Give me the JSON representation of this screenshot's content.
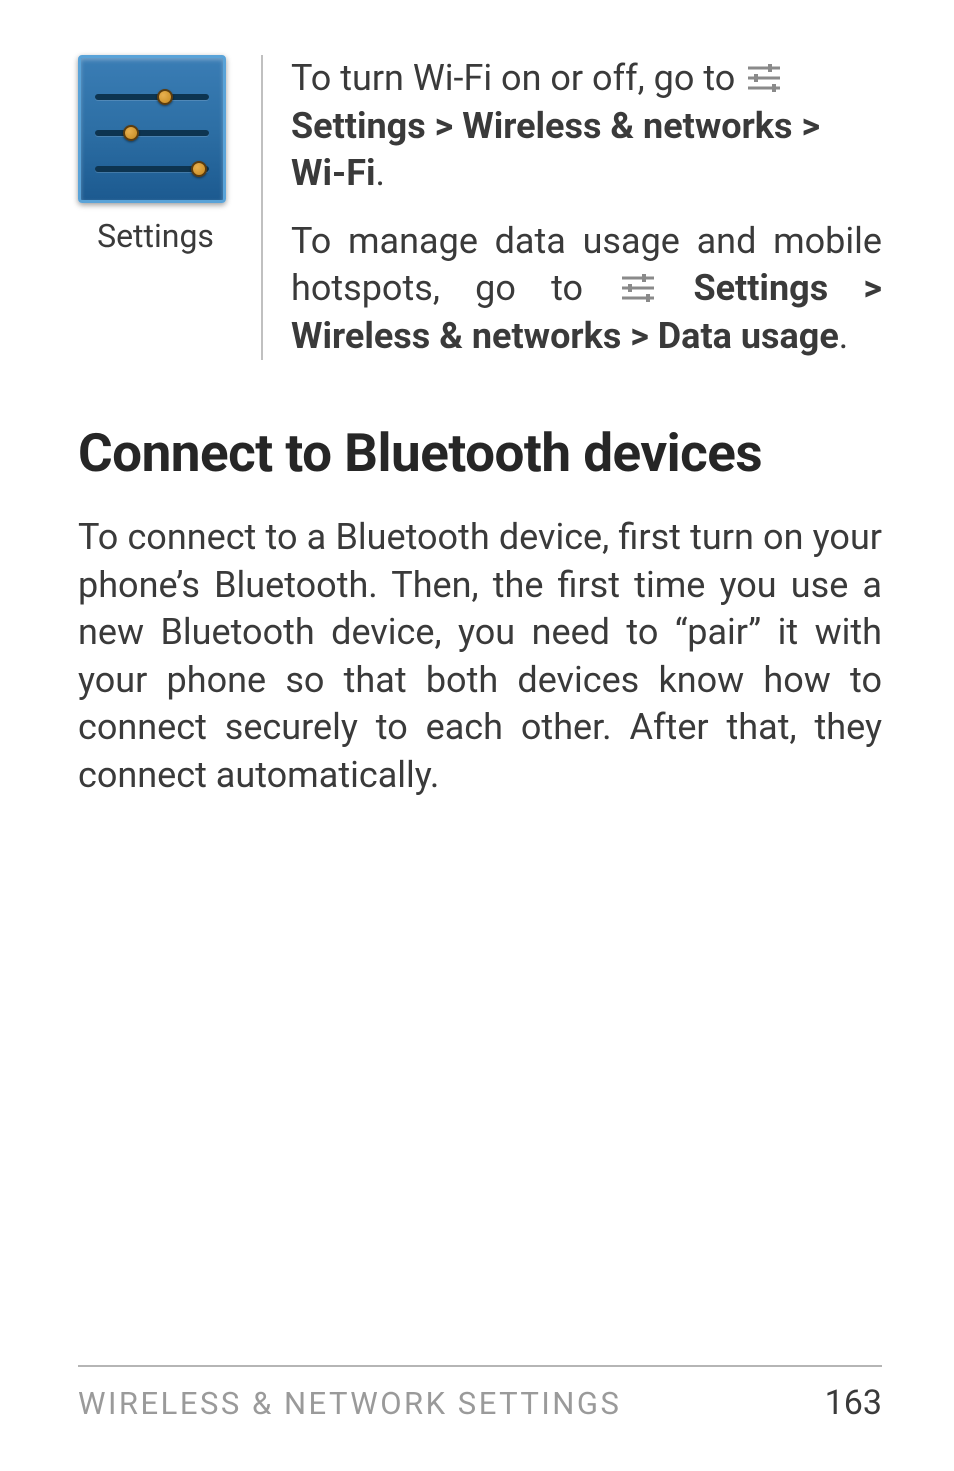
{
  "icon_block": {
    "caption": "Settings"
  },
  "para1": {
    "lead": "To turn Wi-Fi on or off, go to ",
    "bold": "Settings > Wireless & networks > Wi-Fi",
    "tail": "."
  },
  "para2": {
    "lead": "To manage data usage and mobile hotspots, go to ",
    "bold": "Settings > Wireless & networks > Data usage",
    "tail": "."
  },
  "heading": "Connect to Bluetooth devices",
  "body": "To connect to a Bluetooth device, first turn on your phone’s Bluetooth. Then, the first time you use a new Bluetooth device, you need to “pair” it with your phone so that both devices know how to connect securely to each other. After that, they connect automatically.",
  "footer": {
    "title": "WIRELESS & NETWORK SETTINGS",
    "page": "163"
  }
}
